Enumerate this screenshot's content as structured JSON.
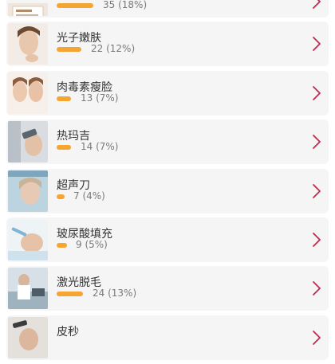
{
  "accent_color": "#f4a532",
  "chevron_color": "#c4294b",
  "items": [
    {
      "title": "",
      "count_text": "35 (18%)",
      "pct": 18,
      "image": "treatment-card-photo"
    },
    {
      "title": "光子嫩肤",
      "count_text": "22 (12%)",
      "pct": 12,
      "image": "woman-face-photo"
    },
    {
      "title": "肉毒素瘦脸",
      "count_text": "13 (7%)",
      "pct": 7,
      "image": "two-faces-photo"
    },
    {
      "title": "热玛吉",
      "count_text": "14 (7%)",
      "pct": 7,
      "image": "device-treatment-photo"
    },
    {
      "title": "超声刀",
      "count_text": "7 (4%)",
      "pct": 4,
      "image": "older-woman-photo"
    },
    {
      "title": "玻尿酸填充",
      "count_text": "9 (5%)",
      "pct": 5,
      "image": "injection-photo"
    },
    {
      "title": "激光脱毛",
      "count_text": "24 (13%)",
      "pct": 13,
      "image": "laser-clinic-photo"
    },
    {
      "title": "皮秒",
      "count_text": "",
      "pct": 0,
      "image": "skin-treatment-photo"
    }
  ]
}
